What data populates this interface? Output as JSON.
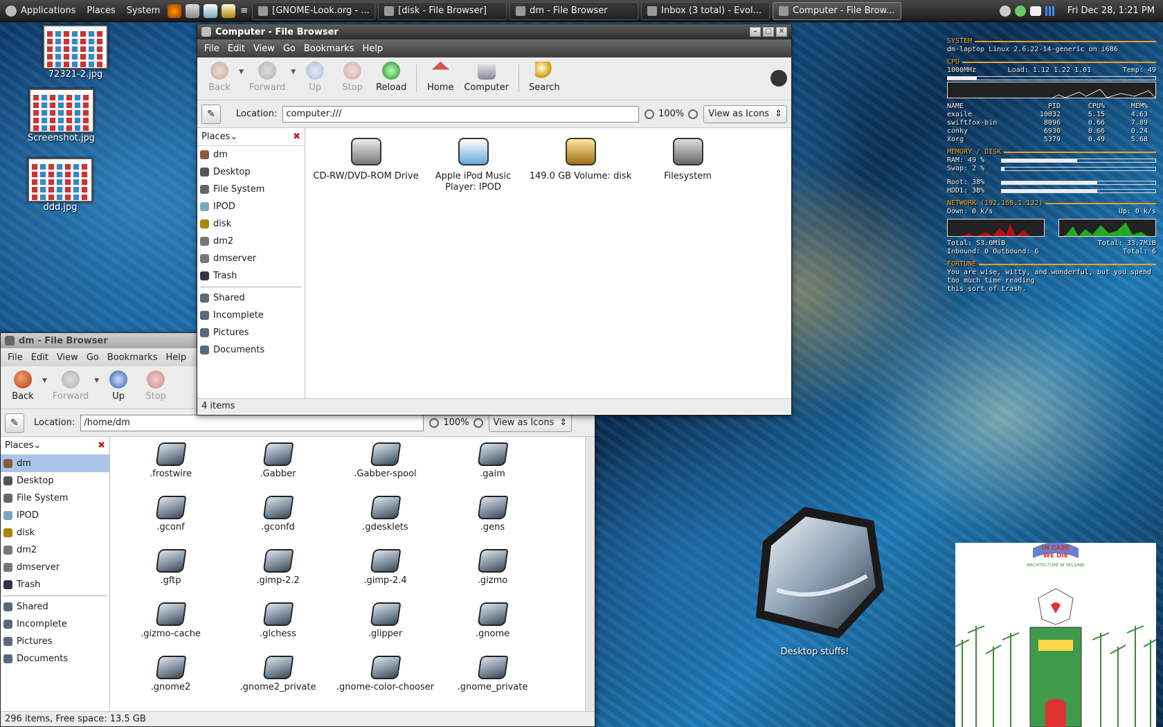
{
  "panel": {
    "menus": [
      "Applications",
      "Places",
      "System"
    ],
    "tasks": [
      {
        "label": "[GNOME-Look.org - ..."
      },
      {
        "label": "[disk - File Browser]"
      },
      {
        "label": "dm - File Browser"
      },
      {
        "label": "Inbox (3 total) - Evol..."
      },
      {
        "label": "Computer - File Brow..."
      }
    ],
    "clock": "Fri Dec 28,  1:21 PM"
  },
  "desktop": {
    "icons": [
      {
        "label": "72321-2.jpg"
      },
      {
        "label": "Screenshot.jpg"
      },
      {
        "label": "ddd.jpg"
      }
    ],
    "big_folder_label": "Desktop stuffs!"
  },
  "win_computer": {
    "title": "Computer - File Browser",
    "menus": [
      "File",
      "Edit",
      "View",
      "Go",
      "Bookmarks",
      "Help"
    ],
    "toolbar": {
      "back": "Back",
      "forward": "Forward",
      "up": "Up",
      "stop": "Stop",
      "reload": "Reload",
      "home": "Home",
      "computer": "Computer",
      "search": "Search"
    },
    "location_label": "Location:",
    "location": "computer:///",
    "zoom": "100%",
    "view": "View as Icons",
    "places_label": "Places",
    "places": [
      "dm",
      "Desktop",
      "File System",
      "IPOD",
      "disk",
      "dm2",
      "dmserver",
      "Trash"
    ],
    "bookmarks": [
      "Shared",
      "Incomplete",
      "Pictures",
      "Documents"
    ],
    "items": [
      {
        "label": "CD-RW/DVD-ROM Drive"
      },
      {
        "label": "Apple iPod Music Player: IPOD"
      },
      {
        "label": "149.0 GB Volume: disk"
      },
      {
        "label": "Filesystem"
      }
    ],
    "status": "4 items"
  },
  "win_dm": {
    "title": "dm - File Browser",
    "menus": [
      "File",
      "Edit",
      "View",
      "Go",
      "Bookmarks",
      "Help"
    ],
    "toolbar": {
      "back": "Back",
      "forward": "Forward",
      "up": "Up",
      "stop": "Stop"
    },
    "location_label": "Location:",
    "location": "/home/dm",
    "zoom": "100%",
    "view": "View as Icons",
    "places_label": "Places",
    "places": [
      "dm",
      "Desktop",
      "File System",
      "IPOD",
      "disk",
      "dm2",
      "dmserver",
      "Trash"
    ],
    "bookmarks": [
      "Shared",
      "Incomplete",
      "Pictures",
      "Documents"
    ],
    "items": [
      ".frostwire",
      ".Gabber",
      ".Gabber-spool",
      ".gaim",
      ".gconf",
      ".gconfd",
      ".gdesklets",
      ".gens",
      ".gftp",
      ".gimp-2.2",
      ".gimp-2.4",
      ".gizmo",
      ".gizmo-cache",
      ".glchess",
      ".glipper",
      ".gnome",
      ".gnome2",
      ".gnome2_private",
      ".gnome-color-chooser",
      ".gnome_private"
    ],
    "status": "296 items, Free space: 13.5 GB"
  },
  "conky": {
    "system_h": "SYSTEM",
    "system": "dm-laptop Linux 2.6.22-14-generic on i686",
    "cpu_h": "CPU",
    "cpu_freq": "1000MHz",
    "cpu_load": "Load: 1.12 1.22 1.01",
    "cpu_temp": "Temp: 49",
    "cpu_usage": 0.14,
    "proc_head": [
      "NAME",
      "PID",
      "CPU%",
      "MEM%"
    ],
    "procs": [
      [
        "exaile",
        "10032",
        "5.15",
        "4.63"
      ],
      [
        "swiftfox-bin",
        "8096",
        "0.66",
        "7.89"
      ],
      [
        "conky",
        "6930",
        "0.66",
        "0.24"
      ],
      [
        "Xorg",
        "5379",
        "0.49",
        "5.68"
      ]
    ],
    "mem_h": "MEMORY / DISK",
    "ram": "RAM:  49 %",
    "ram_v": 0.49,
    "swap": "Swap:  2  %",
    "swap_v": 0.02,
    "root": "Root:  38%",
    "root_v": 0.62,
    "hdd": "HDD1:  38%",
    "hdd_v": 0.62,
    "net_h": "NETWORK (192.168.1.132)",
    "down": "Down: 0     k/s",
    "up": "Up: 0     k/s",
    "total_down": "Total: 53.0MiB",
    "total_up": "Total: 33.7MiB",
    "inbound": "Inbound: 0 Outbound: 6",
    "total": "Total: 6",
    "fortune_h": "FORTUNE",
    "fortune": [
      "You are wise, witty, and wonderful, but you spend",
      "too much time reading",
      "this sort of trash."
    ]
  },
  "poster": {
    "line1": "IN CASE",
    "line2": "WE DIE",
    "line3": "ARCHITECTURE IN HELSINKI"
  },
  "colors": {
    "accent": "#f5a020",
    "selection": "#a9c6e8"
  }
}
